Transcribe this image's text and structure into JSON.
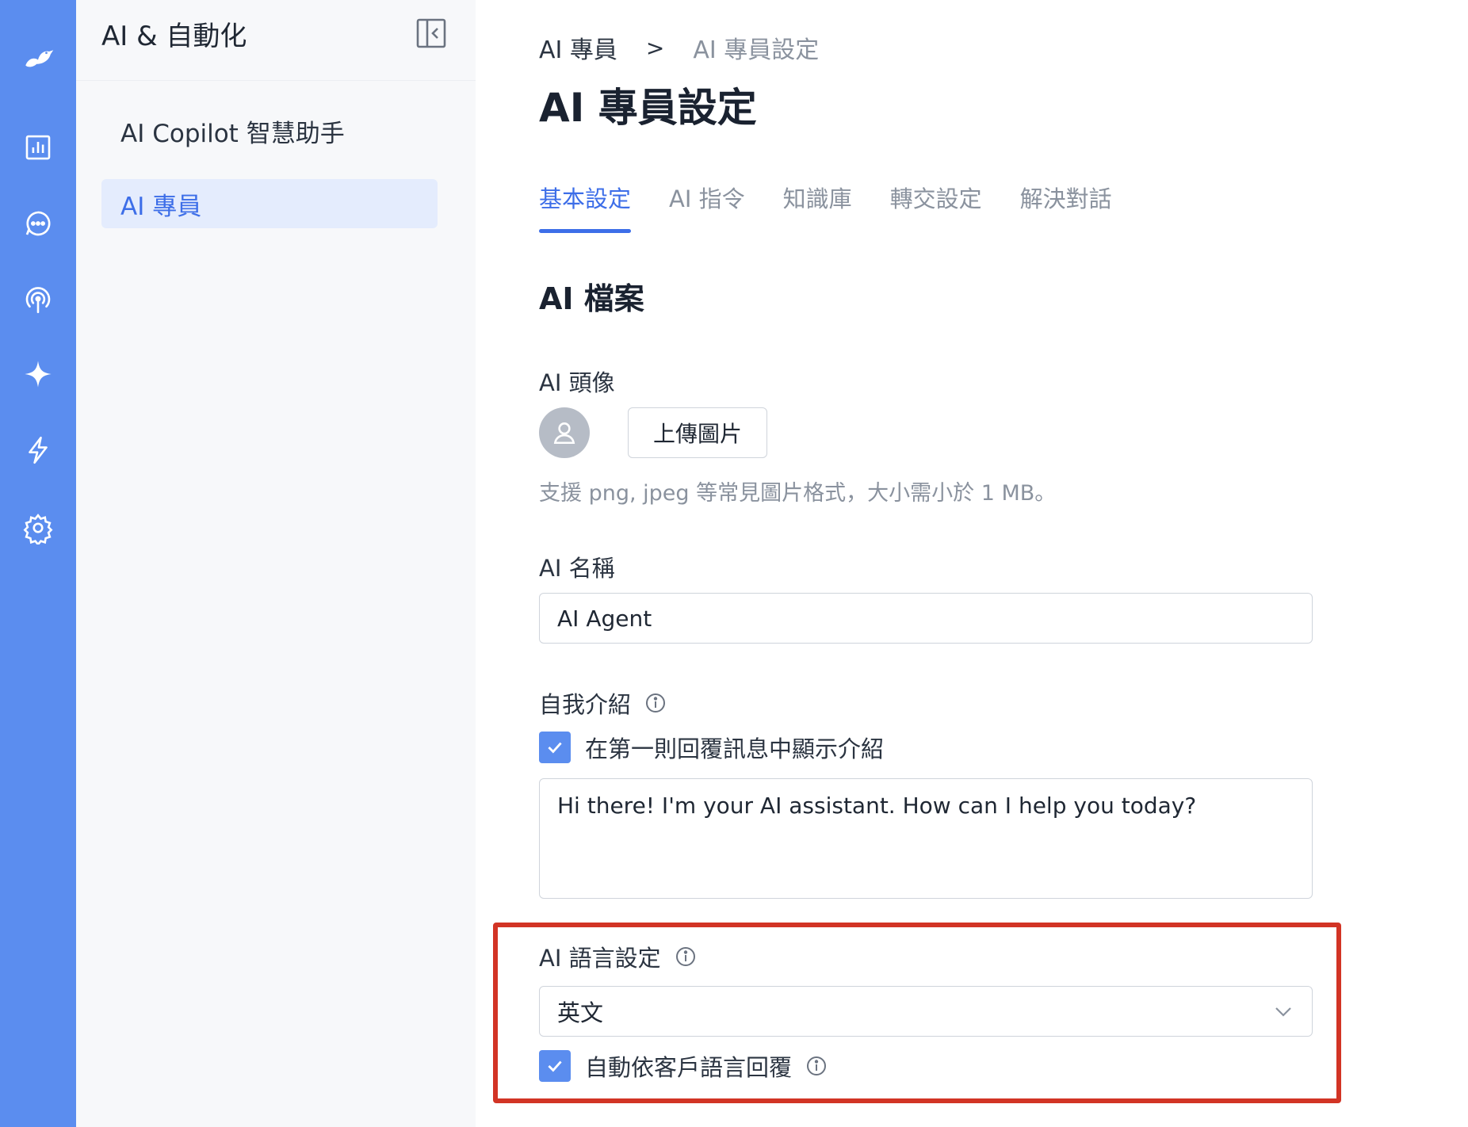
{
  "rail": {
    "icons": [
      "logo-icon",
      "analytics-icon",
      "chat-icon",
      "broadcast-icon",
      "ai-sparkle-icon",
      "automation-icon",
      "settings-icon"
    ]
  },
  "sidebar": {
    "title": "AI & 自動化",
    "items": [
      {
        "label": "AI Copilot 智慧助手"
      },
      {
        "label": "AI 專員"
      }
    ]
  },
  "breadcrumb": {
    "parent": "AI 專員",
    "separator": ">",
    "current": "AI 專員設定"
  },
  "page": {
    "title": "AI 專員設定"
  },
  "tabs": [
    {
      "label": "基本設定"
    },
    {
      "label": "AI 指令"
    },
    {
      "label": "知識庫"
    },
    {
      "label": "轉交設定"
    },
    {
      "label": "解決對話"
    }
  ],
  "profile": {
    "section_title": "AI 檔案",
    "avatar_label": "AI 頭像",
    "upload_button": "上傳圖片",
    "upload_hint": "支援 png, jpeg 等常見圖片格式，大小需小於 1 MB。",
    "name_label": "AI 名稱",
    "name_value": "AI Agent",
    "intro_label": "自我介紹",
    "intro_checkbox_label": "在第一則回覆訊息中顯示介紹",
    "intro_value": "Hi there! I'm your AI assistant. How can I help you today?",
    "language_label": "AI 語言設定",
    "language_value": "英文",
    "auto_language_label": "自動依客戶語言回覆"
  },
  "colors": {
    "rail": "#5b8def",
    "accent": "#3d6ee8",
    "highlight": "#d23425"
  }
}
